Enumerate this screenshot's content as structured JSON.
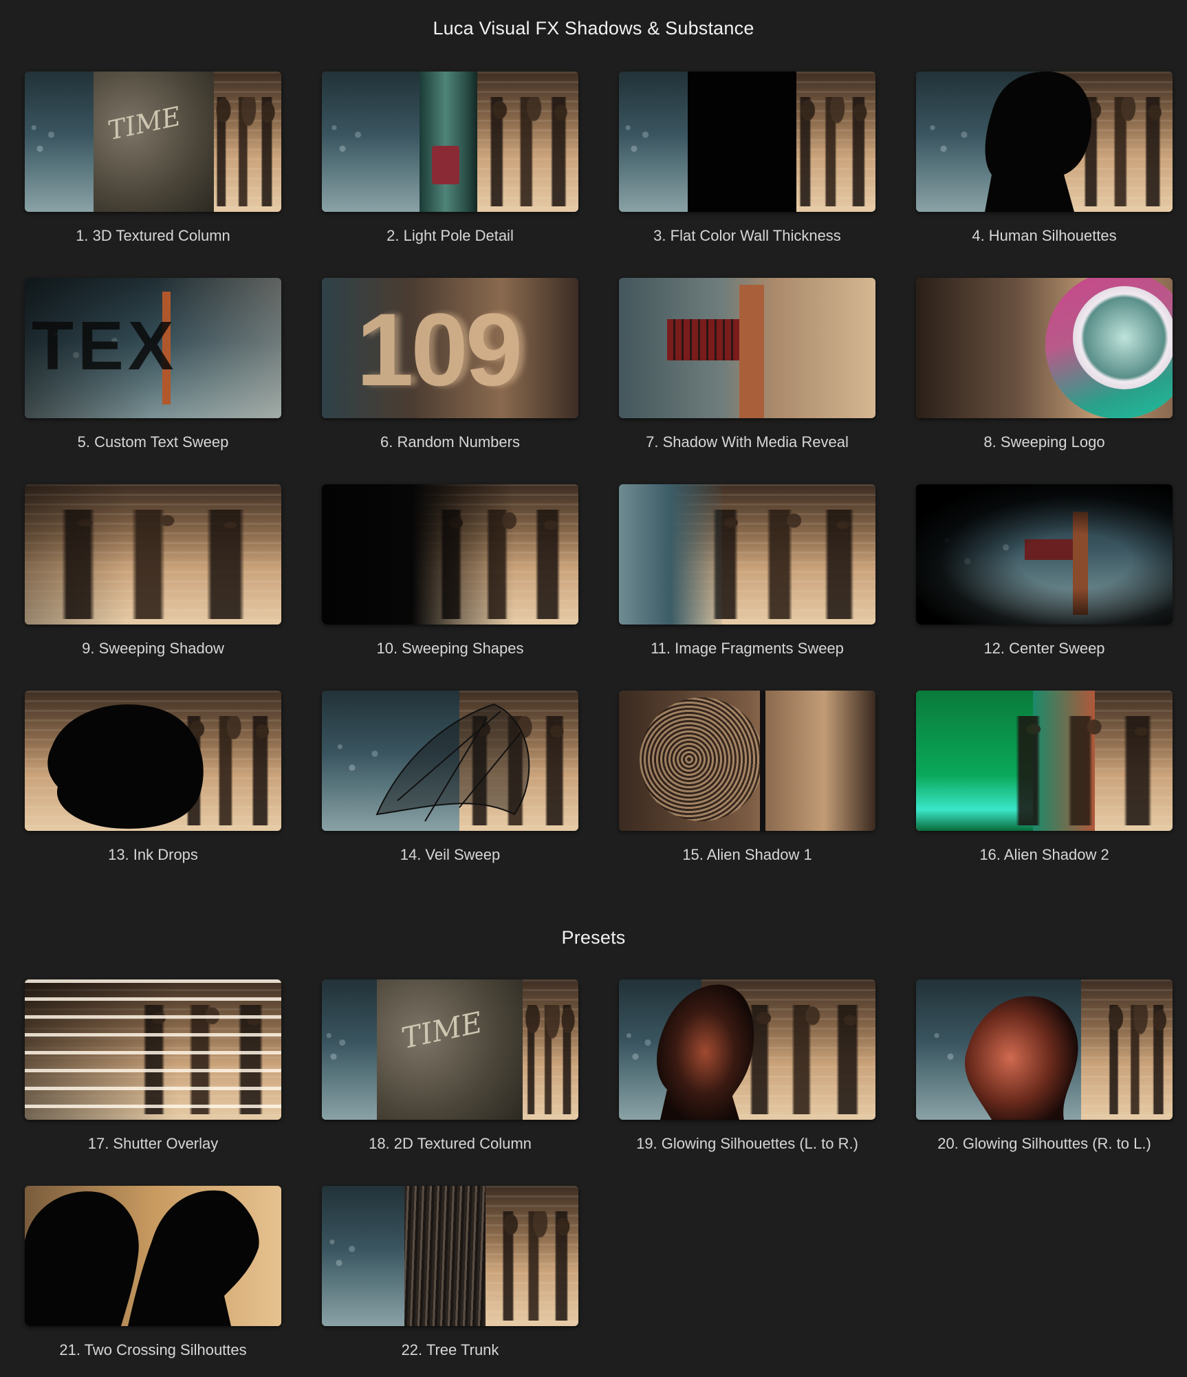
{
  "page": {
    "title": "Luca Visual FX Shadows & Substance",
    "presets_title": "Presets"
  },
  "items": [
    {
      "label": "1. 3D Textured Column",
      "overlay_text": "TIME"
    },
    {
      "label": "2. Light Pole Detail"
    },
    {
      "label": "3. Flat Color Wall Thickness"
    },
    {
      "label": "4. Human Silhouettes"
    },
    {
      "label": "5. Custom Text Sweep",
      "overlay_text": "TEX"
    },
    {
      "label": "6. Random Numbers",
      "overlay_text": "109"
    },
    {
      "label": "7. Shadow With Media Reveal"
    },
    {
      "label": "8. Sweeping Logo"
    },
    {
      "label": "9. Sweeping Shadow"
    },
    {
      "label": "10. Sweeping Shapes"
    },
    {
      "label": "11. Image Fragments Sweep"
    },
    {
      "label": "12. Center Sweep"
    },
    {
      "label": "13. Ink Drops"
    },
    {
      "label": "14. Veil Sweep"
    },
    {
      "label": "15. Alien Shadow 1"
    },
    {
      "label": "16. Alien Shadow 2"
    }
  ],
  "presets": [
    {
      "label": "17. Shutter Overlay"
    },
    {
      "label": "18. 2D Textured Column",
      "overlay_text": "TIME"
    },
    {
      "label": "19. Glowing Silhouettes (L. to R.)"
    },
    {
      "label": "20. Glowing Silhouttes (R. to L.)"
    },
    {
      "label": "21. Two Crossing Silhouttes"
    },
    {
      "label": "22. Tree Trunk"
    }
  ],
  "colors": {
    "background": "#1e1e1e",
    "title_text": "#f2f2f2",
    "label_text": "#d7d7d7"
  }
}
